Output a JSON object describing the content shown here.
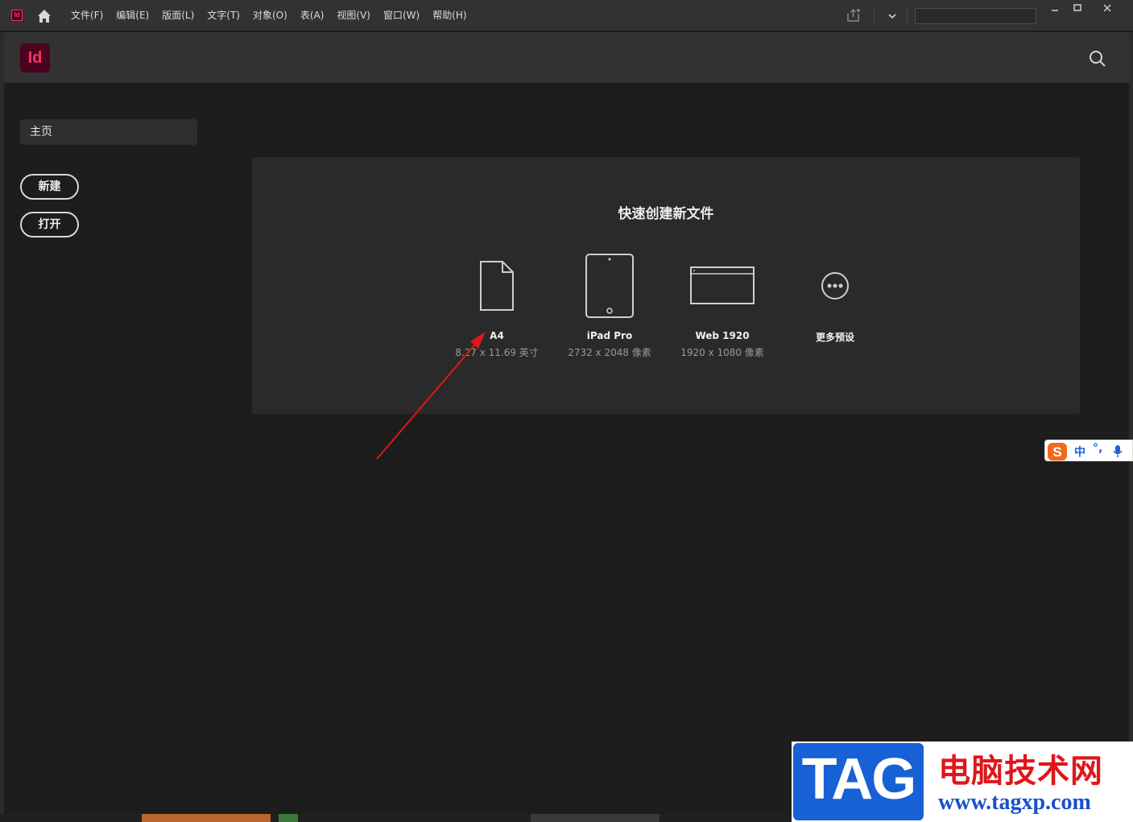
{
  "app": {
    "mini_icon_label": "Id",
    "logo_label": "Id",
    "accent_color": "#ff3366",
    "logo_bg": "#49021f"
  },
  "menubar": {
    "items": [
      "文件(F)",
      "编辑(E)",
      "版面(L)",
      "文字(T)",
      "对象(O)",
      "表(A)",
      "视图(V)",
      "窗口(W)",
      "帮助(H)"
    ],
    "search_value": ""
  },
  "sidebar": {
    "home_label": "主页",
    "new_label": "新建",
    "open_label": "打开"
  },
  "quick_create": {
    "title": "快速创建新文件",
    "presets": [
      {
        "name": "A4",
        "size": "8.27 x 11.69 英寸",
        "icon": "document-icon"
      },
      {
        "name": "iPad Pro",
        "size": "2732 x 2048 像素",
        "icon": "tablet-icon"
      },
      {
        "name": "Web 1920",
        "size": "1920 x 1080 像素",
        "icon": "browser-window-icon"
      },
      {
        "name": "更多预设",
        "size": "",
        "icon": "more-icon"
      }
    ]
  },
  "ime": {
    "mode": "中",
    "punctuation": "°,"
  },
  "watermark": {
    "tag": "TAG",
    "site_name": "电脑技术网",
    "url": "www.tagxp.com"
  }
}
